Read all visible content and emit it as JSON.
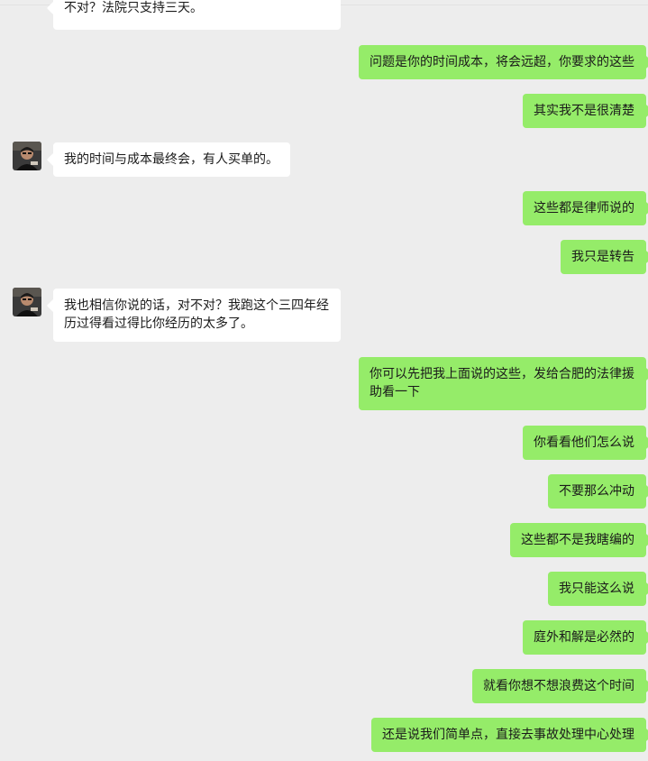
{
  "chat": {
    "messages": [
      {
        "side": "left",
        "text": "不对？法院只支持三天。"
      },
      {
        "side": "right",
        "text": "问题是你的时间成本，将会远超，你要求的这些"
      },
      {
        "side": "right",
        "text": "其实我不是很清楚"
      },
      {
        "side": "left",
        "text": "我的时间与成本最终会，有人买单的。"
      },
      {
        "side": "right",
        "text": "这些都是律师说的"
      },
      {
        "side": "right",
        "text": "我只是转告"
      },
      {
        "side": "left",
        "text": "我也相信你说的话，对不对？我跑这个三四年经历过得看过得比你经历的太多了。"
      },
      {
        "side": "right",
        "text": "你可以先把我上面说的这些，发给合肥的法律援助看一下"
      },
      {
        "side": "right",
        "text": "你看看他们怎么说"
      },
      {
        "side": "right",
        "text": "不要那么冲动"
      },
      {
        "side": "right",
        "text": "这些都不是我瞎编的"
      },
      {
        "side": "right",
        "text": "我只能这么说"
      },
      {
        "side": "right",
        "text": "庭外和解是必然的"
      },
      {
        "side": "right",
        "text": "就看你想不想浪费这个时间"
      },
      {
        "side": "right",
        "text": "还是说我们简单点，直接去事故处理中心处理"
      }
    ]
  },
  "colors": {
    "background": "#ededed",
    "sent_bubble": "#95ec69",
    "received_bubble": "#ffffff",
    "text": "#1a1a1a"
  }
}
